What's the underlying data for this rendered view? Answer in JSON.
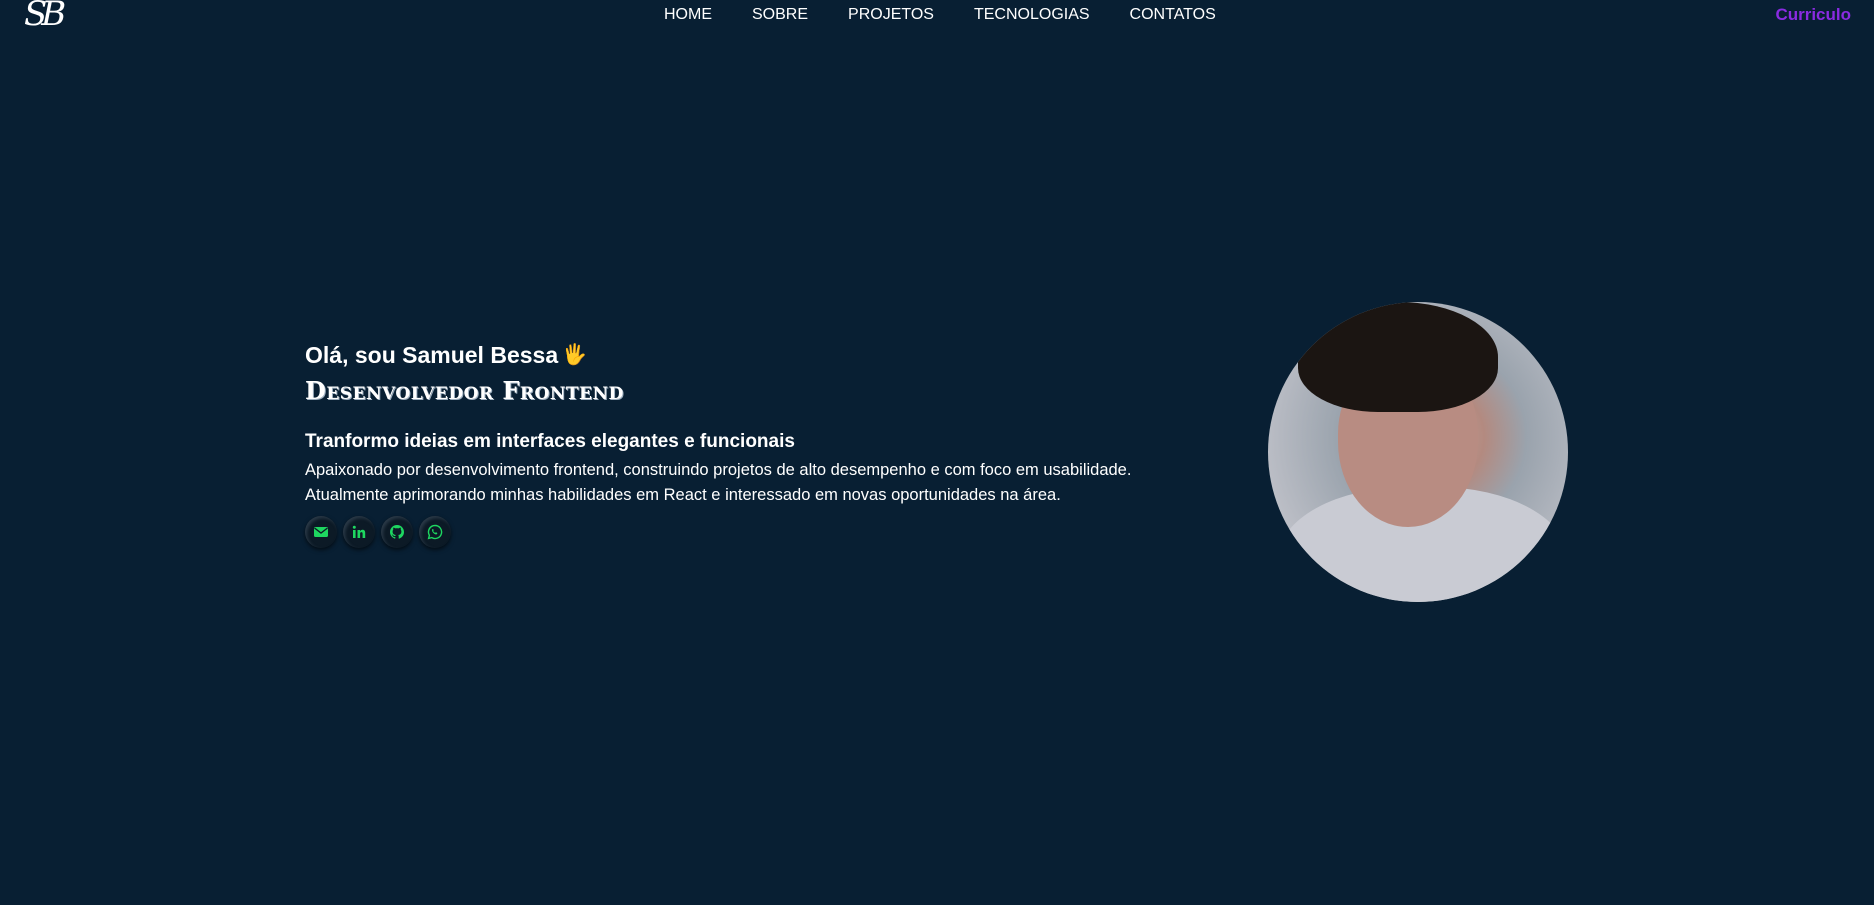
{
  "header": {
    "logo": "SB",
    "nav": [
      "HOME",
      "SOBRE",
      "PROJETOS",
      "TECNOLOGIAS",
      "CONTATOS"
    ],
    "cv_label": "Curriculo",
    "cv_color": "#8a2be2"
  },
  "hero": {
    "greeting": "Olá, sou Samuel Bessa",
    "wave_emoji": "🖐",
    "role": "Desenvolvedor Frontend",
    "tagline": "Tranformo ideias em interfaces elegantes e funcionais",
    "description_line1": "Apaixonado por desenvolvimento frontend, construindo projetos de alto desempenho e com foco em usabilidade.",
    "description_line2": "Atualmente aprimorando minhas habilidades em React e interessado em novas oportunidades na área.",
    "socials": [
      {
        "icon": "email-icon"
      },
      {
        "icon": "linkedin-icon"
      },
      {
        "icon": "github-icon"
      },
      {
        "icon": "whatsapp-icon"
      }
    ],
    "social_icon_color": "#1ed760"
  },
  "colors": {
    "background": "#081f33",
    "text": "#ffffff"
  }
}
